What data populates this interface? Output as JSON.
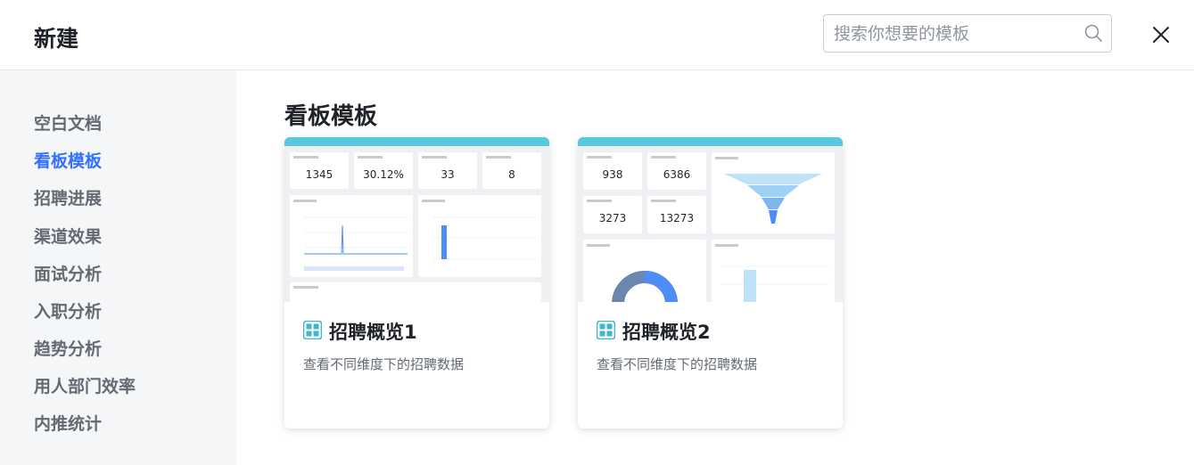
{
  "header": {
    "title": "新建",
    "search_placeholder": "搜索你想要的模板"
  },
  "sidebar": {
    "items": [
      {
        "label": "空白文档"
      },
      {
        "label": "看板模板"
      },
      {
        "label": "招聘进展"
      },
      {
        "label": "渠道效果"
      },
      {
        "label": "面试分析"
      },
      {
        "label": "入职分析"
      },
      {
        "label": "趋势分析"
      },
      {
        "label": "用人部门效率"
      },
      {
        "label": "内推统计"
      }
    ],
    "active_label": "看板模板"
  },
  "main": {
    "section_title": "看板模板",
    "cards": [
      {
        "name": "招聘概览1",
        "description": "查看不同维度下的招聘数据",
        "preview_numbers": [
          "1345",
          "30.12%",
          "33",
          "8"
        ]
      },
      {
        "name": "招聘概览2",
        "description": "查看不同维度下的招聘数据",
        "preview_numbers": [
          "938",
          "6386",
          "3273",
          "13273"
        ]
      }
    ]
  },
  "colors": {
    "accent": "#3370ff",
    "card_header_bar": "#5ac8dc",
    "icon_teal": "#3fb6c9"
  },
  "icons": [
    "search-icon",
    "close-icon",
    "dashboard-grid-icon"
  ]
}
